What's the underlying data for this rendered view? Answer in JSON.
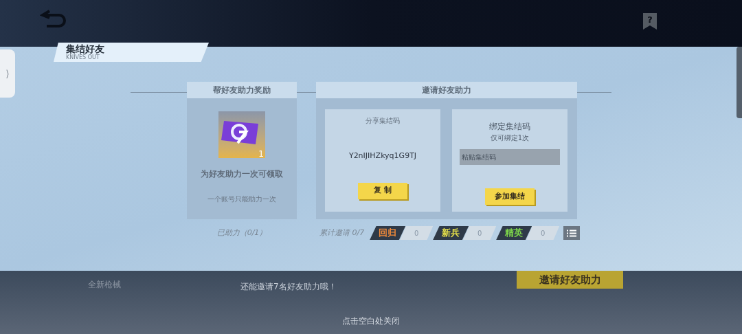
{
  "background": {
    "weapon_caption": "全新枪械",
    "invite_hint": "还能邀请7名好友助力哦！",
    "invite_button": "邀请好友助力",
    "close_hint": "点击空白处关闭"
  },
  "side_tab": {
    "glyph": "⟩"
  },
  "help_glyph": "?",
  "dialog": {
    "title": "集结好友",
    "subtitle": "KNIVES OUT",
    "reward_panel": {
      "header": "帮好友助力奖励",
      "item_count": "1",
      "description": "为好友助力一次可领取",
      "note": "一个账号只能助力一次",
      "status": "已助力（0/1）"
    },
    "invite_panel": {
      "header": "邀请好友助力",
      "share": {
        "label": "分享集结码",
        "code": "Y2nIJIHZkyq1G9TJ",
        "button": "复 制"
      },
      "bind": {
        "label": "绑定集结码",
        "note": "仅可绑定1次",
        "placeholder": "粘贴集结码",
        "button": "参加集结"
      },
      "total": "累计邀请 0/7",
      "tallies": [
        {
          "label": "回归",
          "count": "0",
          "color": "#f08a3a"
        },
        {
          "label": "新兵",
          "count": "0",
          "color": "#e6e04a"
        },
        {
          "label": "精英",
          "count": "0",
          "color": "#7ed64a"
        }
      ]
    }
  }
}
